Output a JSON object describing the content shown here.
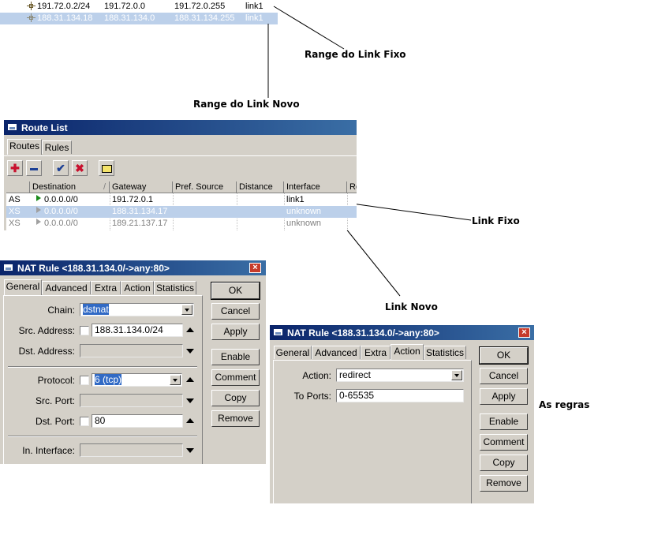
{
  "address_strip": {
    "rows": [
      {
        "address": "191.72.0.2/24",
        "network": "191.72.0.0",
        "broadcast": "191.72.0.255",
        "interface": "link1",
        "selected": false
      },
      {
        "address": "188.31.134.18",
        "network": "188.31.134.0",
        "broadcast": "188.31.134.255",
        "interface": "link1",
        "selected": true
      }
    ]
  },
  "annotations": {
    "range_fixo": "Range do Link Fixo",
    "range_novo": "Range do Link Novo",
    "link_fixo": "Link Fixo",
    "link_novo": "Link Novo",
    "as_regras": "As regras"
  },
  "route_list": {
    "title": "Route List",
    "tabs": [
      "Routes",
      "Rules"
    ],
    "columns": [
      "Destination",
      "Gateway",
      "Pref. Source",
      "Distance",
      "Interface",
      "Ro"
    ],
    "sort_indicator": "/",
    "rows": [
      {
        "flags": "AS",
        "destination": "0.0.0.0/0",
        "gateway": "191.72.0.1",
        "pref_source": "",
        "distance": "",
        "interface": "link1",
        "state": "active"
      },
      {
        "flags": "XS",
        "destination": "0.0.0.0/0",
        "gateway": "188.31.134.17",
        "pref_source": "",
        "distance": "",
        "interface": "unknown",
        "state": "selected"
      },
      {
        "flags": "XS",
        "destination": "0.0.0.0/0",
        "gateway": "189.21.137.17",
        "pref_source": "",
        "distance": "",
        "interface": "unknown",
        "state": "disabled"
      }
    ],
    "toolbar_icons": [
      "add-icon",
      "remove-icon",
      "enable-icon",
      "disable-icon",
      "comment-icon"
    ]
  },
  "nat_general": {
    "title": "NAT Rule <188.31.134.0/->any:80>",
    "tabs": [
      "General",
      "Advanced",
      "Extra",
      "Action",
      "Statistics"
    ],
    "active_tab": "General",
    "fields": {
      "chain_label": "Chain:",
      "chain_value": "dstnat",
      "src_address_label": "Src. Address:",
      "src_address_value": "188.31.134.0/24",
      "dst_address_label": "Dst. Address:",
      "protocol_label": "Protocol:",
      "protocol_value": "6 (tcp)",
      "src_port_label": "Src. Port:",
      "dst_port_label": "Dst. Port:",
      "dst_port_value": "80",
      "in_interface_label": "In. Interface:"
    },
    "buttons": [
      "OK",
      "Cancel",
      "Apply",
      "Enable",
      "Comment",
      "Copy",
      "Remove"
    ]
  },
  "nat_action": {
    "title": "NAT Rule <188.31.134.0/->any:80>",
    "tabs": [
      "General",
      "Advanced",
      "Extra",
      "Action",
      "Statistics"
    ],
    "active_tab": "Action",
    "fields": {
      "action_label": "Action:",
      "action_value": "redirect",
      "to_ports_label": "To Ports:",
      "to_ports_value": "0-65535"
    },
    "buttons": [
      "OK",
      "Cancel",
      "Apply",
      "Enable",
      "Comment",
      "Copy",
      "Remove"
    ]
  },
  "colors": {
    "title_start": "#0a246a",
    "title_end": "#3a6ea5",
    "selection": "#bcd0ea",
    "window_bg": "#d4d0c8",
    "close_red": "#c63b2b"
  }
}
